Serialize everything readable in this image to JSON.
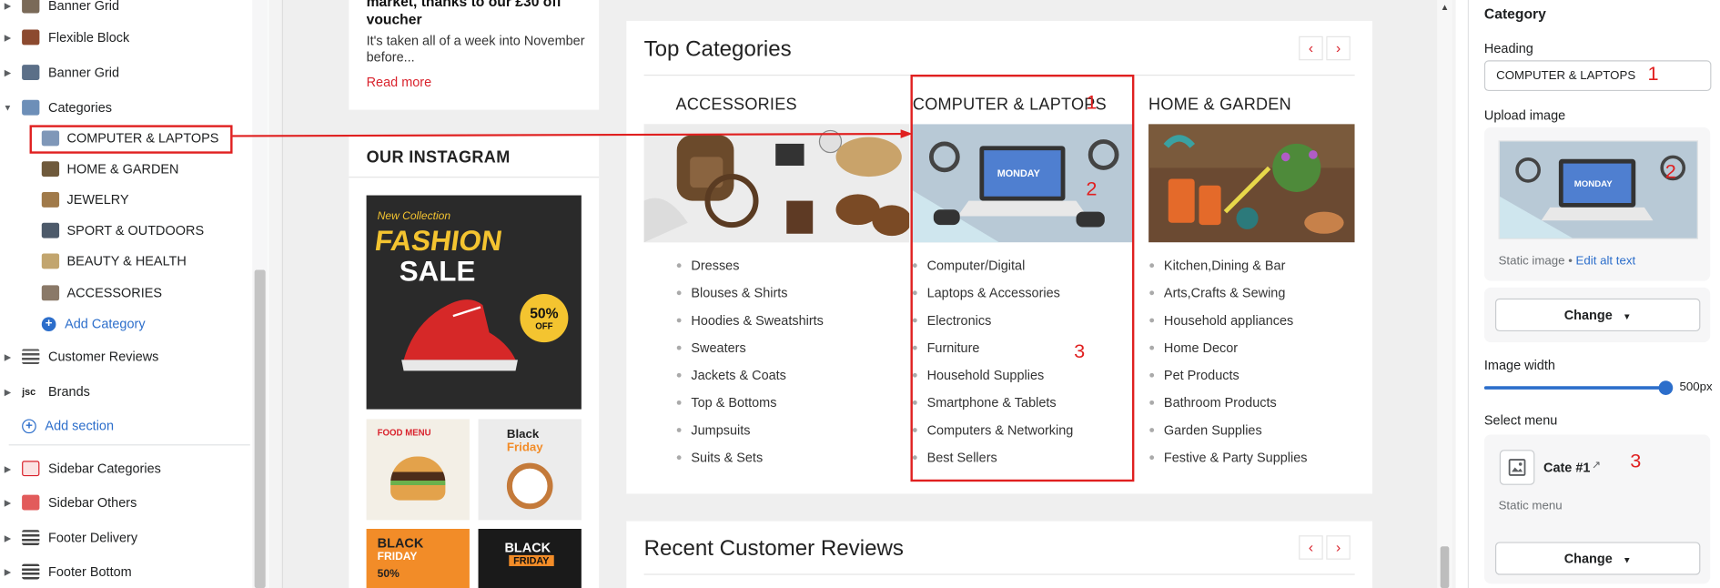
{
  "sidebar": {
    "items": [
      {
        "label": "Banner Grid",
        "color": "#7a6a58"
      },
      {
        "label": "Flexible Block",
        "color": "#8c4a2f"
      },
      {
        "label": "Banner Grid",
        "color": "#5b6f88"
      },
      {
        "label": "Categories",
        "color": "#6d8fb8"
      }
    ],
    "categories": [
      {
        "label": "COMPUTER & LAPTOPS",
        "color": "#7f97b8"
      },
      {
        "label": "HOME & GARDEN",
        "color": "#6f5a3c"
      },
      {
        "label": "JEWELRY",
        "color": "#a07a4a"
      },
      {
        "label": "SPORT & OUTDOORS",
        "color": "#4d5a6a"
      },
      {
        "label": "BEAUTY & HEALTH",
        "color": "#c2a56e"
      },
      {
        "label": "ACCESSORIES",
        "color": "#8a7968"
      }
    ],
    "add_category": "Add Category",
    "more_items": [
      {
        "label": "Customer Reviews"
      },
      {
        "label": "Brands"
      }
    ],
    "add_section": "Add section",
    "footer_items": [
      {
        "label": "Sidebar Categories"
      },
      {
        "label": "Sidebar Others"
      },
      {
        "label": "Footer Delivery"
      },
      {
        "label": "Footer Bottom"
      }
    ]
  },
  "preview": {
    "blog": {
      "title_line1": "market, thanks to our £30 off",
      "title_line2": "voucher",
      "body_line1": "It's taken all of a week into November",
      "body_line2": "before...",
      "read_more": "Read more"
    },
    "instagram": {
      "title": "OUR INSTAGRAM",
      "big_post_line1": "New Collection",
      "big_post_line2": "FASHION",
      "big_post_line3": "SALE",
      "big_badge": "50%",
      "big_badge_sub": "OFF",
      "tile1_title": "FOOD MENU",
      "tile2_line1": "Black",
      "tile2_line2": "Friday",
      "tile3_line1": "BLACK",
      "tile3_line2": "FRIDAY",
      "tile3_badge": "50%",
      "tile4_line1": "BLACK",
      "tile4_line2": "FRIDAY"
    },
    "top_categories": {
      "title": "Top Categories",
      "prev": "‹",
      "next": "›",
      "columns": [
        {
          "title": "ACCESSORIES",
          "items": [
            "Dresses",
            "Blouses & Shirts",
            "Hoodies & Sweatshirts",
            "Sweaters",
            "Jackets & Coats",
            "Top & Bottoms",
            "Jumpsuits",
            "Suits & Sets"
          ]
        },
        {
          "title": "COMPUTER & LAPTOPS",
          "items": [
            "Computer/Digital",
            "Laptops & Accessories",
            "Electronics",
            "Furniture",
            "Household Supplies",
            "Smartphone & Tablets",
            "Computers & Networking",
            "Best Sellers"
          ]
        },
        {
          "title": "HOME & GARDEN",
          "items": [
            "Kitchen,Dining & Bar",
            "Arts,Crafts & Sewing",
            "Household appliances",
            "Home Decor",
            "Pet Products",
            "Bathroom Products",
            "Garden Supplies",
            "Festive & Party Supplies"
          ]
        }
      ],
      "laptop_screen": "MONDAY"
    },
    "reviews": {
      "title": "Recent Customer Reviews",
      "prev": "‹",
      "next": "›"
    },
    "annotations": {
      "n1": "1",
      "n2": "2",
      "n3": "3"
    },
    "scroll_up": "▲"
  },
  "settings": {
    "title": "Category",
    "heading_label": "Heading",
    "heading_value": "COMPUTER & LAPTOPS",
    "upload_label": "Upload image",
    "static_image": "Static image",
    "edit_alt": "Edit alt text",
    "change_label": "Change",
    "image_width_label": "Image width",
    "image_width_value": "500px",
    "image_width_fraction": 1.0,
    "select_menu_label": "Select menu",
    "menu_name": "Cate #1",
    "static_menu": "Static menu",
    "laptop_screen": "MONDAY",
    "annotations": {
      "n1": "1",
      "n2": "2",
      "n3": "3"
    }
  },
  "colors": {
    "accent_blue": "#2c6ecb",
    "annotation_red": "#e02020",
    "brand_red": "#d9232d"
  }
}
